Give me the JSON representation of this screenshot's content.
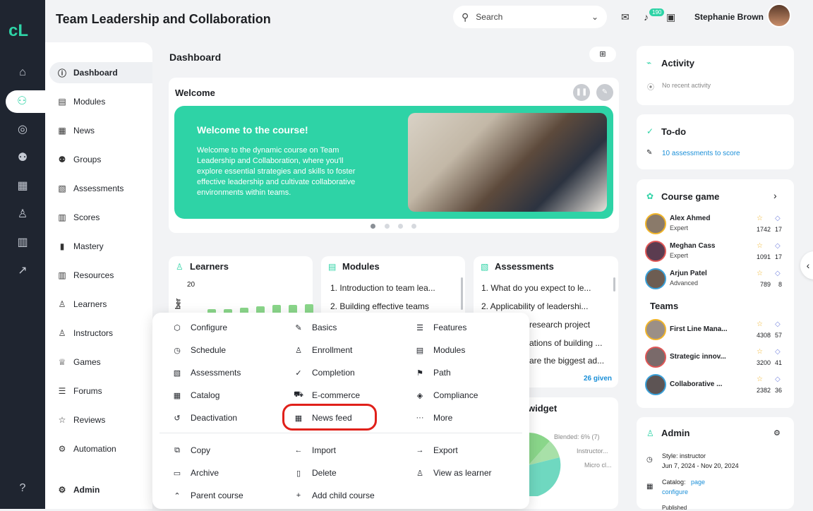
{
  "header": {
    "title": "Team Leadership and Collaboration",
    "search_placeholder": "Search",
    "notifications_count": "190",
    "user_name": "Stephanie Brown"
  },
  "rail": {
    "logo": "cL",
    "icons": [
      "home-icon",
      "courses-icon",
      "target-icon",
      "users-icon",
      "apps-icon",
      "person-icon",
      "library-icon",
      "chart-icon",
      "help-icon"
    ]
  },
  "sidebar": {
    "items": [
      "Dashboard",
      "Modules",
      "News",
      "Groups",
      "Assessments",
      "Scores",
      "Mastery",
      "Resources",
      "Learners",
      "Instructors",
      "Games",
      "Forums",
      "Reviews",
      "Automation"
    ],
    "admin_label": "Admin"
  },
  "dashboard": {
    "title": "Dashboard",
    "welcome_title": "Welcome",
    "banner_heading": "Welcome to the course!",
    "banner_text": "Welcome to the dynamic course on Team Leadership and Collaboration, where you'll explore essential strategies and skills to foster effective leadership and cultivate collaborative environments within teams."
  },
  "learners": {
    "title": "Learners",
    "y_max": "20",
    "axis_label": "ber",
    "bar_levels": [
      0.55,
      0.55,
      0.6,
      0.65,
      0.7,
      0.7,
      0.72,
      0.72
    ]
  },
  "modules": {
    "title": "Modules",
    "items": [
      "1.  Introduction to team lea...",
      "2.  Building effective teams"
    ]
  },
  "assessments": {
    "title": "Assessments",
    "items": [
      "1.  What do you expect to le...",
      "2.  Applicability of leadershi...",
      "research project",
      "ations of building ...",
      "are the biggest ad..."
    ],
    "given": "26 given"
  },
  "widget": {
    "title": "widget",
    "labels": [
      "Blended: 6% (7)",
      "Instructor...",
      "Micro cl..."
    ]
  },
  "menu": {
    "col1": [
      "Configure",
      "Schedule",
      "Assessments",
      "Catalog",
      "Deactivation"
    ],
    "col2": [
      "Basics",
      "Enrollment",
      "Completion",
      "E-commerce",
      "News feed"
    ],
    "col3": [
      "Features",
      "Modules",
      "Path",
      "Compliance",
      "More"
    ],
    "bottom1": [
      "Copy",
      "Archive",
      "Parent course"
    ],
    "bottom2": [
      "Import",
      "Delete",
      "Add child course"
    ],
    "bottom3": [
      "Export",
      "View as learner"
    ]
  },
  "activity": {
    "title": "Activity",
    "empty": "No recent activity"
  },
  "todo": {
    "title": "To-do",
    "item": "10 assessments to score"
  },
  "course_game": {
    "title": "Course game",
    "players": [
      {
        "name": "Alex Ahmed",
        "role": "Expert",
        "points": "1742",
        "level": "17"
      },
      {
        "name": "Meghan Cass",
        "role": "Expert",
        "points": "1091",
        "level": "17"
      },
      {
        "name": "Arjun Patel",
        "role": "Advanced",
        "points": "789",
        "level": "8"
      }
    ],
    "teams_title": "Teams",
    "teams": [
      {
        "name": "First Line Mana...",
        "points": "4308",
        "level": "57"
      },
      {
        "name": "Strategic innov...",
        "points": "3200",
        "level": "41"
      },
      {
        "name": "Collaborative ...",
        "points": "2382",
        "level": "36"
      }
    ]
  },
  "admin": {
    "title": "Admin",
    "style_line": "Style: instructor",
    "dates": "Jun 7, 2024 - Nov 20, 2024",
    "catalog_label": "Catalog:",
    "catalog_link": "page",
    "catalog_link2": "configure",
    "published": "Published"
  }
}
